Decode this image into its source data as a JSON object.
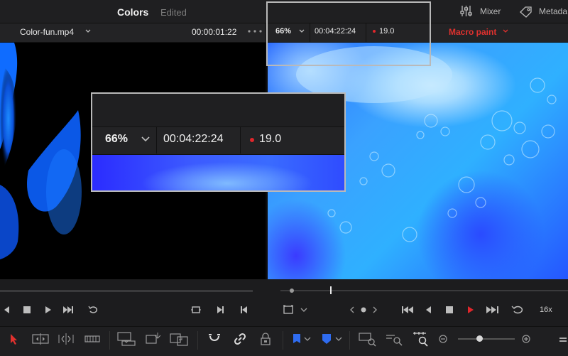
{
  "header": {
    "title": "Colors",
    "status": "Edited",
    "mixer_label": "Mixer",
    "metadata_label": "Metada"
  },
  "left_viewer": {
    "clip_name": "Color-fun.mp4",
    "timecode": "00:00:01:22"
  },
  "right_viewer": {
    "zoom": "66%",
    "timecode": "00:04:22:24",
    "fps": "19.0",
    "node_name": "Macro paint"
  },
  "zoom_callout": {
    "zoom": "66%",
    "timecode": "00:04:22:24",
    "fps": "19.0"
  },
  "transport": {
    "speed": "16x"
  },
  "colors": {
    "accent_red": "#e0312e",
    "record_dot": "#e0262b",
    "selection_blue": "#2f6cf0"
  },
  "icons": [
    "mixer-icon",
    "metadata-icon",
    "chevron-down-icon",
    "more-dots-icon",
    "skip-back-icon",
    "stop-icon",
    "play-icon",
    "skip-forward-icon",
    "loop-icon",
    "go-first-icon",
    "go-last-icon",
    "prev-frame-icon",
    "next-frame-icon",
    "pointer-icon",
    "trim-icon",
    "dynamic-trim-icon",
    "blade-icon",
    "insert-icon",
    "overwrite-icon",
    "replace-icon",
    "snap-icon",
    "link-icon",
    "lock-icon",
    "flag-icon",
    "marker-icon",
    "zoom-icon"
  ]
}
